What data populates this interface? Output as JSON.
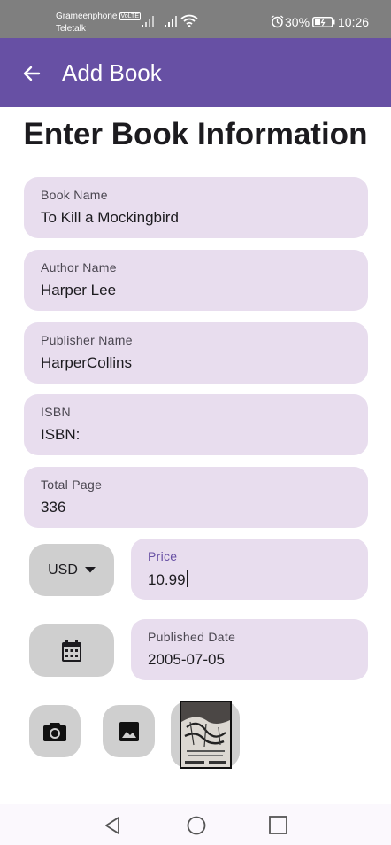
{
  "status_bar": {
    "carrier_1": "Grameenphone",
    "carrier_1_badge": "VoLTE",
    "carrier_2": "Teletalk",
    "battery_percent": "30%",
    "time": "10:26"
  },
  "app_bar": {
    "title": "Add Book",
    "back_icon": "arrow-back-icon"
  },
  "page_heading": "Enter Book Information",
  "form": {
    "book_name": {
      "label": "Book Name",
      "value": "To Kill a Mockingbird"
    },
    "author_name": {
      "label": "Author Name",
      "value": "Harper Lee"
    },
    "publisher_name": {
      "label": "Publisher Name",
      "value": "HarperCollins"
    },
    "isbn": {
      "label": "ISBN",
      "value": "ISBN:"
    },
    "total_page": {
      "label": "Total Page",
      "value": "336"
    },
    "currency": {
      "selected": "USD",
      "icon": "dropdown-arrow-icon"
    },
    "price": {
      "label": "Price",
      "value": "10.99",
      "focused": true
    },
    "date_picker": {
      "icon": "calendar-icon"
    },
    "published_date": {
      "label": "Published Date",
      "value": "2005-07-05"
    },
    "camera": {
      "icon": "camera-icon"
    },
    "gallery": {
      "icon": "image-icon"
    },
    "cover_thumbnail": {
      "icon": "book-cover-thumbnail"
    }
  },
  "nav_bar": {
    "back": "nav-back-icon",
    "home": "nav-home-icon",
    "recents": "nav-recents-icon"
  },
  "colors": {
    "primary": "#6750a4",
    "field_background": "#e8ddee",
    "button_background": "#cfcfcf",
    "status_bar": "#7f7f7f"
  }
}
